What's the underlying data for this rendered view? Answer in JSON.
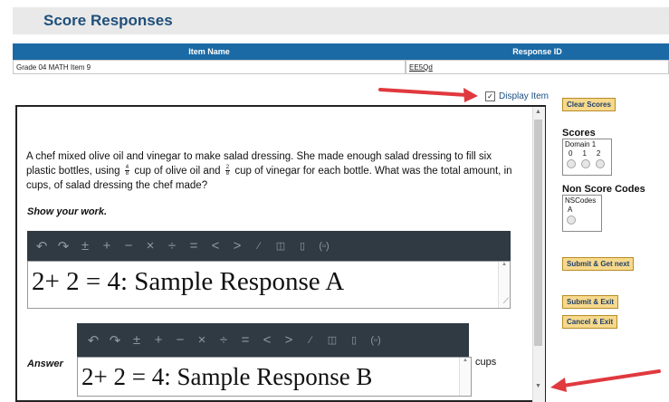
{
  "page": {
    "title": "Score Responses"
  },
  "table": {
    "headers": {
      "item_name": "Item Name",
      "response_id": "Response ID"
    },
    "row": {
      "item_name": "Grade 04 MATH Item 9",
      "response_id": "EE5Qd"
    }
  },
  "display_item": {
    "label": "Display Item",
    "checked": true
  },
  "question": {
    "text_part1": "A chef mixed olive oil and vinegar to make salad dressing. She made enough salad dressing to fill six plastic bottles, using",
    "frac1": {
      "num": "4",
      "den": "8"
    },
    "text_part2": "cup of olive oil and",
    "frac2": {
      "num": "2",
      "den": "8"
    },
    "text_part3": "cup of vinegar for each bottle. What was the total amount, in cups, of salad dressing the chef made?",
    "show_work": "Show your work."
  },
  "editor_toolbar": {
    "icons": [
      "undo-icon",
      "redo-icon",
      "plus-minus-icon",
      "plus-icon",
      "minus-icon",
      "times-icon",
      "divide-icon",
      "equals-icon",
      "less-than-icon",
      "greater-than-icon",
      "fraction-icon",
      "mixed-number-icon",
      "fraction-template-icon",
      "parentheses-icon"
    ],
    "glyphs": [
      "↶",
      "↷",
      "±",
      "+",
      "−",
      "×",
      "÷",
      "=",
      "<",
      ">",
      "⁄",
      "◫",
      "▯",
      "(▫)"
    ]
  },
  "response_a": {
    "text": "2+ 2 =  4: Sample Response A"
  },
  "response_b": {
    "label": "Answer",
    "text": "2+ 2 =  4: Sample Response B",
    "unit": "cups"
  },
  "sidebar": {
    "clear_scores": "Clear Scores",
    "scores_heading": "Scores",
    "domain_label": "Domain 1",
    "score_options": [
      "0",
      "1",
      "2"
    ],
    "non_score_heading": "Non Score Codes",
    "nscodes_label": "NSCodes",
    "nscode_options": [
      "A"
    ],
    "submit_next": "Submit & Get next",
    "submit_exit": "Submit & Exit",
    "cancel_exit": "Cancel & Exit"
  },
  "colors": {
    "header_blue": "#1b6aa5",
    "title_blue": "#1f4f7a",
    "button_gold": "#f7d98c",
    "arrow_red": "#e0393e",
    "toolbar_dark": "#2f3a43"
  }
}
